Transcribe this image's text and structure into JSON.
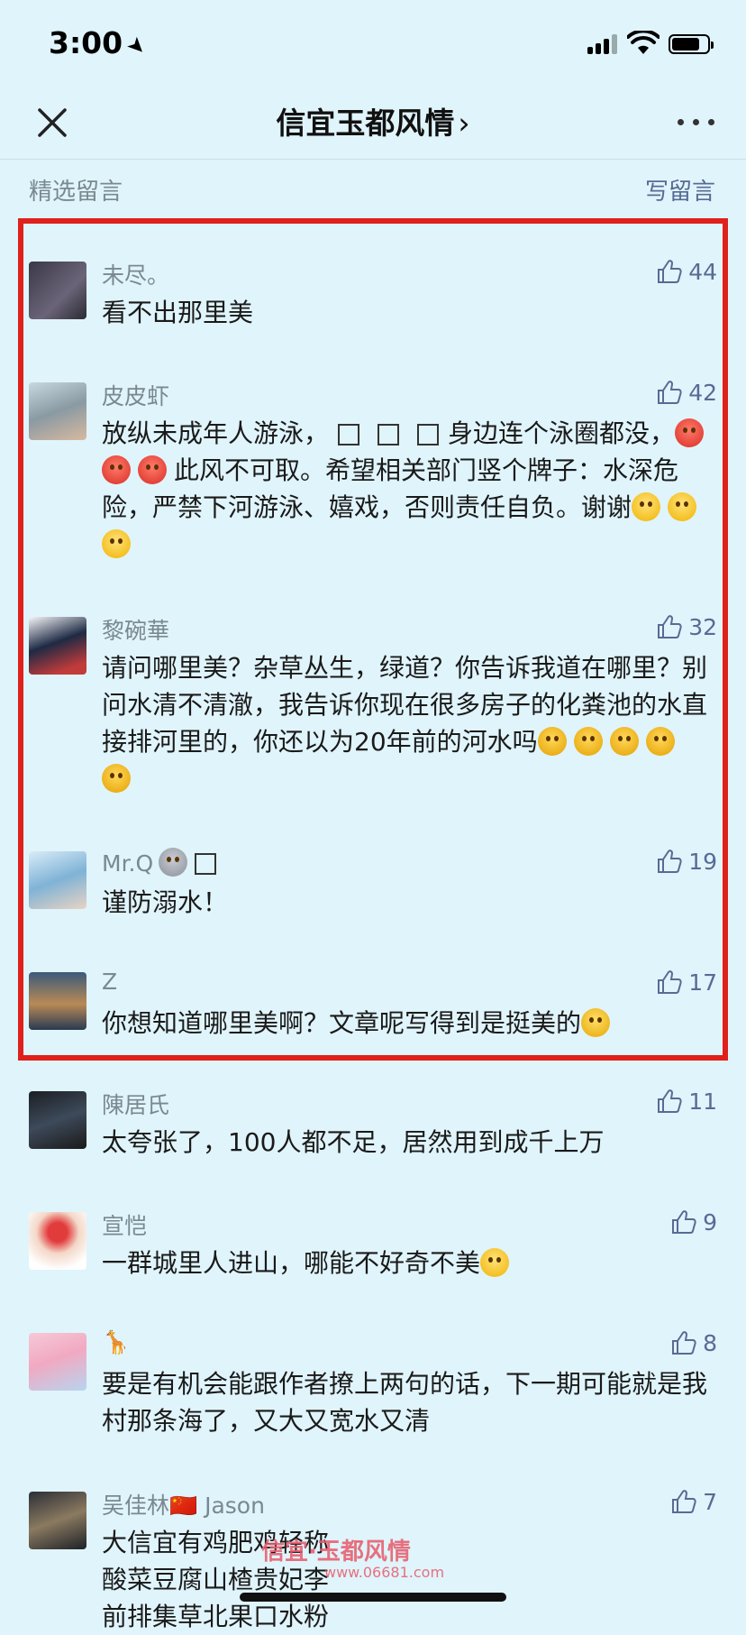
{
  "status_bar": {
    "time": "3:00",
    "location_icon": "location-arrow-icon",
    "signal_icon": "cellular-signal-icon",
    "wifi_icon": "wifi-icon",
    "battery_icon": "battery-icon",
    "battery_level": 0.8
  },
  "nav": {
    "title": "信宜玉都风情",
    "title_chevron": "›",
    "close_icon": "close-icon",
    "more_icon": "more-dots-icon"
  },
  "section": {
    "title": "精选留言",
    "write_link": "写留言"
  },
  "comments": [
    {
      "nickname": "未尽。",
      "likes": "44",
      "text": "看不出那里美"
    },
    {
      "nickname": "皮皮虾",
      "likes": "42",
      "text_parts": [
        "放纵未成年人游泳，",
        "身边连个泳圈都没，",
        "此风不可取。希望相关部门竖个牌子：水深危险，严禁下河游泳、嬉戏，否则责任自负。谢谢"
      ]
    },
    {
      "nickname": "黎碗華",
      "likes": "32",
      "text": "请问哪里美？杂草丛生，绿道？你告诉我道在哪里？别问水清不清澈，我告诉你现在很多房子的化粪池的水直接排河里的，你还以为20年前的河水吗"
    },
    {
      "nickname": "Mr.Q",
      "likes": "19",
      "text": "谨防溺水！"
    },
    {
      "nickname": "Z",
      "likes": "17",
      "text": "你想知道哪里美啊？文章呢写得到是挺美的"
    },
    {
      "nickname": "陳居氏",
      "likes": "11",
      "text": "太夸张了，100人都不足，居然用到成千上万"
    },
    {
      "nickname": "宣恺",
      "likes": "9",
      "text": "一群城里人进山，哪能不好奇不美"
    },
    {
      "nickname": "🦒",
      "likes": "8",
      "text": "要是有机会能跟作者撩上两句的话，下一期可能就是我村那条海了，又大又宽水又清"
    },
    {
      "nickname": "吴佳林🇨🇳 Jason",
      "likes": "7",
      "lines": [
        "大信宜有鸡肥鸡轻称",
        "酸菜豆腐山楂贵妃李",
        "前排集草北果口水粉"
      ]
    }
  ],
  "watermark": {
    "text": "信宜·玉都风情",
    "url": "www.06681.com"
  },
  "like_icon": "thumbs-up-icon"
}
